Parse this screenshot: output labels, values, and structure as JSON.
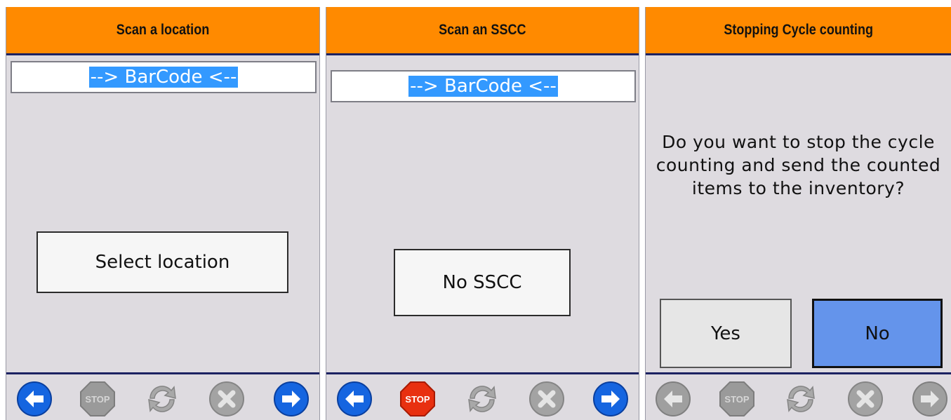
{
  "screens": [
    {
      "title": "Scan a location",
      "barcode_placeholder": "--> BarCode <--",
      "button_label": "Select location",
      "toolbar": {
        "back": "enabled",
        "stop": "disabled",
        "refresh": "disabled",
        "cancel": "disabled",
        "next": "enabled"
      }
    },
    {
      "title": "Scan an SSCC",
      "barcode_placeholder": "--> BarCode <--",
      "button_label": "No SSCC",
      "toolbar": {
        "back": "enabled",
        "stop": "enabled",
        "refresh": "disabled",
        "cancel": "disabled",
        "next": "enabled"
      }
    },
    {
      "title": "Stopping Cycle counting",
      "question": "Do you want to stop the cycle counting and send the counted items to the inventory?",
      "yes_label": "Yes",
      "no_label": "No",
      "toolbar": {
        "back": "disabled",
        "stop": "disabled",
        "refresh": "disabled",
        "cancel": "disabled",
        "next": "disabled"
      }
    }
  ],
  "icons": {
    "stop_text": "STOP",
    "icon_names": [
      "back-arrow-icon",
      "stop-sign-icon",
      "refresh-icon",
      "cancel-icon",
      "forward-arrow-icon"
    ]
  },
  "colors": {
    "header": "#ff8a00",
    "panel": "#dedbe0",
    "accent_blue": "#1565e0",
    "highlight": "#3399ff",
    "no_button": "#6494eb",
    "stop_red": "#e83010",
    "disabled": "#9a9a9a"
  }
}
